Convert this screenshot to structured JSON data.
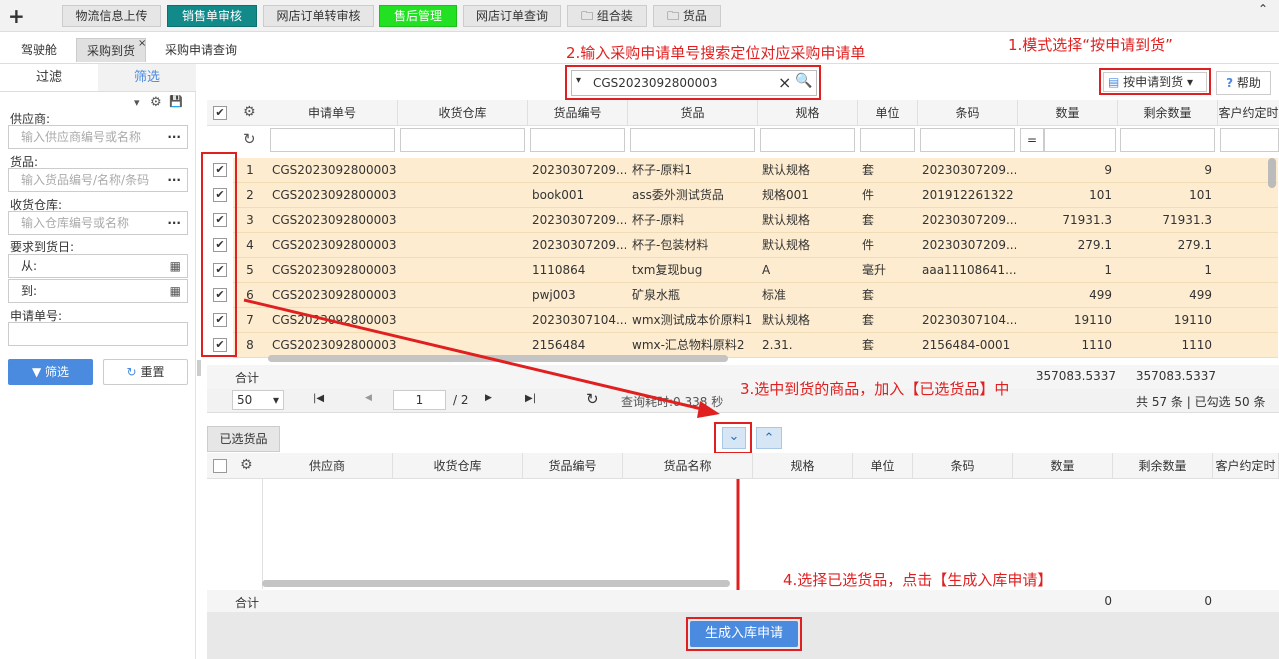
{
  "topbar": {
    "plus": "+",
    "tabs": [
      "物流信息上传",
      "销售单审核",
      "网店订单转审核",
      "售后管理",
      "网店订单查询",
      "组合装",
      "货品"
    ]
  },
  "subtabs": [
    "驾驶舱",
    "采购到货",
    "采购申请查询"
  ],
  "left": {
    "tab_filter": "过滤",
    "tab_select": "筛选",
    "supplier_label": "供应商:",
    "supplier_ph": "输入供应商编号或名称",
    "goods_label": "货品:",
    "goods_ph": "输入货品编号/名称/条码",
    "warehouse_label": "收货仓库:",
    "warehouse_ph": "输入仓库编号或名称",
    "date_label": "要求到货日:",
    "from": "从:",
    "to": "到:",
    "apply_no_label": "申请单号:",
    "filter_btn": "筛选",
    "reset_btn": "重置"
  },
  "search": {
    "value": "CGS2023092800003"
  },
  "annotations": {
    "a1": "1.模式选择“按申请到货”",
    "a2": "2.输入采购申请单号搜索定位对应采购申请单",
    "a3": "3.选中到货的商品，加入【已选货品】中",
    "a4": "4.选择已选货品，点击【生成入库申请】"
  },
  "mode_btn": "按申请到货",
  "help_btn": "帮助",
  "grid": {
    "headers": [
      "申请单号",
      "收货仓库",
      "货品编号",
      "货品",
      "规格",
      "单位",
      "条码",
      "数量",
      "剩余数量",
      "客户约定时"
    ],
    "rows": [
      {
        "no": "1",
        "apply": "CGS2023092800003",
        "code": "20230307209...",
        "name": "杯子-原料1",
        "spec": "默认规格",
        "unit": "套",
        "barcode": "20230307209...",
        "qty": "9",
        "remain": "9"
      },
      {
        "no": "2",
        "apply": "CGS2023092800003",
        "code": "book001",
        "name": "ass委外测试货品",
        "spec": "规格001",
        "unit": "件",
        "barcode": "201912261322",
        "qty": "101",
        "remain": "101"
      },
      {
        "no": "3",
        "apply": "CGS2023092800003",
        "code": "20230307209...",
        "name": "杯子-原料",
        "spec": "默认规格",
        "unit": "套",
        "barcode": "20230307209...",
        "qty": "71931.3",
        "remain": "71931.3"
      },
      {
        "no": "4",
        "apply": "CGS2023092800003",
        "code": "20230307209...",
        "name": "杯子-包装材料",
        "spec": "默认规格",
        "unit": "件",
        "barcode": "20230307209...",
        "qty": "279.1",
        "remain": "279.1"
      },
      {
        "no": "5",
        "apply": "CGS2023092800003",
        "code": "1110864",
        "name": "txm复现bug",
        "spec": "A",
        "unit": "毫升",
        "barcode": "aaa11108641...",
        "qty": "1",
        "remain": "1"
      },
      {
        "no": "6",
        "apply": "CGS2023092800003",
        "code": "pwj003",
        "name": "矿泉水瓶",
        "spec": "标准",
        "unit": "套",
        "barcode": "",
        "qty": "499",
        "remain": "499"
      },
      {
        "no": "7",
        "apply": "CGS2023092800003",
        "code": "20230307104...",
        "name": "wmx测试成本价原料1",
        "spec": "默认规格",
        "unit": "套",
        "barcode": "20230307104...",
        "qty": "19110",
        "remain": "19110"
      },
      {
        "no": "8",
        "apply": "CGS2023092800003",
        "code": "2156484",
        "name": "wmx-汇总物料原料2",
        "spec": "2.31.",
        "unit": "套",
        "barcode": "2156484-0001",
        "qty": "1110",
        "remain": "1110"
      }
    ],
    "total_label": "合计",
    "total_qty": "357083.5337",
    "total_remain": "357083.5337",
    "eq": "=",
    "check": "✔"
  },
  "pager": {
    "size": "50",
    "page": "1",
    "of": "/ 2",
    "query_info": "查询耗时:0.338 秒",
    "summary": "共 57 条 | 已勾选 50 条"
  },
  "selected": {
    "tab": "已选货品",
    "headers": [
      "供应商",
      "收货仓库",
      "货品编号",
      "货品名称",
      "规格",
      "单位",
      "条码",
      "数量",
      "剩余数量",
      "客户约定时"
    ],
    "total_label": "合计",
    "total_qty": "0",
    "total_remain": "0"
  },
  "generate_btn": "生成入库申请",
  "icons": {
    "gear": "⚙",
    "refresh": "↻",
    "save": "💾",
    "search": "🔍",
    "clear": "×",
    "caret": "▾",
    "first": "|◀",
    "prev": "◀",
    "next": "▶",
    "last": "▶|",
    "reload": "↻",
    "down": "⌄",
    "up": "⌃",
    "calendar": "▦",
    "more": "···",
    "folder": "🗀",
    "filter": "▼"
  },
  "colors": {
    "accent": "#4a8be0",
    "annotation": "#e02020",
    "row_bg": "#fdeccf"
  }
}
